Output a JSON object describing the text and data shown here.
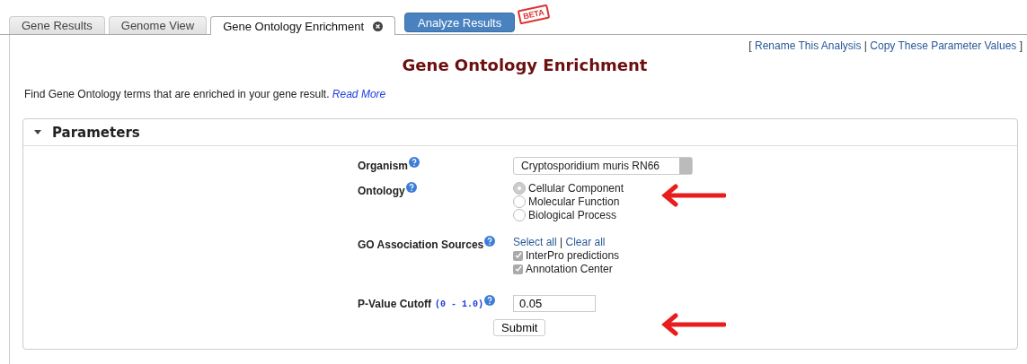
{
  "tabs": [
    {
      "label": "Gene Results",
      "kind": "tab",
      "selected": false
    },
    {
      "label": "Genome View",
      "kind": "tab",
      "selected": false
    },
    {
      "label": "Gene Ontology Enrichment",
      "kind": "tab",
      "selected": true,
      "closable": true
    },
    {
      "label": "Analyze Results",
      "kind": "button",
      "selected": false
    }
  ],
  "beta_badge": "BETA",
  "link_bar": {
    "open": "[",
    "separator": "|",
    "close": "]",
    "links": [
      "Rename This Analysis",
      "Copy These Parameter Values"
    ]
  },
  "title": "Gene Ontology Enrichment",
  "description": "Find Gene Ontology terms that are enriched in your gene result.",
  "read_more": "Read More",
  "parameters": {
    "title": "Parameters",
    "expanded": true,
    "organism": {
      "label": "Organism",
      "value": "Cryptosporidium muris RN66"
    },
    "ontology": {
      "label": "Ontology",
      "options": [
        {
          "label": "Cellular Component",
          "selected": true
        },
        {
          "label": "Molecular Function",
          "selected": false
        },
        {
          "label": "Biological Process",
          "selected": false
        }
      ]
    },
    "sources": {
      "label": "GO Association Sources",
      "select_all": "Select all",
      "separator": "|",
      "clear_all": "Clear all",
      "options": [
        {
          "label": "InterPro predictions",
          "checked": true
        },
        {
          "label": "Annotation Center",
          "checked": true
        }
      ]
    },
    "pvalue": {
      "label": "P-Value Cutoff",
      "range": "(0 - 1.0)",
      "value": "0.05"
    },
    "submit": "Submit"
  }
}
